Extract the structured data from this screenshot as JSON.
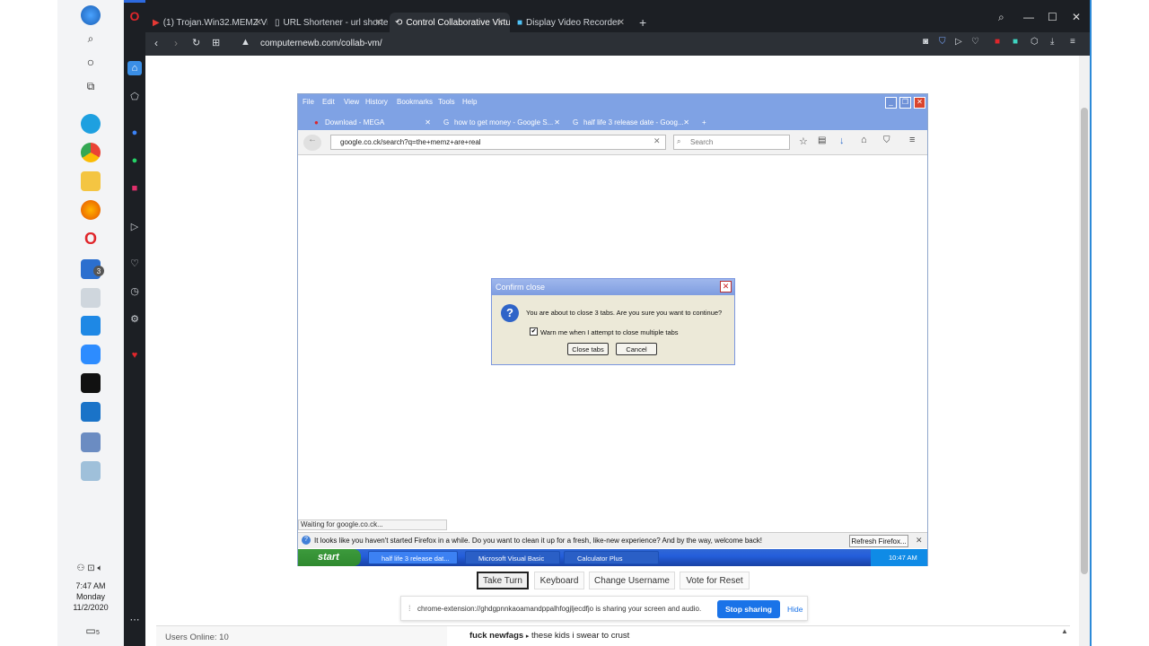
{
  "opera": {
    "tabs": [
      {
        "label": "(1) Trojan.Win32.MEMZ Vi",
        "icon_color": "#e53935"
      },
      {
        "label": "URL Shortener - url shortel",
        "icon_color": "#ffffff"
      },
      {
        "label": "Control Collaborative Virtu",
        "icon_color": "#cccccc"
      },
      {
        "label": "Display Video Recorder",
        "icon_color": "#4fc3f7"
      }
    ],
    "url": "computernewb.com/collab-vm/"
  },
  "windows": {
    "clock": {
      "time": "7:47 AM",
      "day": "Monday",
      "date": "11/2/2020"
    },
    "mail_badge": "3",
    "notif_badge": "5"
  },
  "vm": {
    "firefox": {
      "menu": [
        "File",
        "Edit",
        "View",
        "History",
        "Bookmarks",
        "Tools",
        "Help"
      ],
      "tabs": [
        "Download - MEGA",
        "how to get money - Google S...",
        "half life 3 release date - Goog..."
      ],
      "url": "google.co.ck/search?q=the+memz+are+real",
      "search_placeholder": "Search",
      "status": "Waiting for google.co.ck...",
      "notification": "It looks like you haven't started Firefox in a while. Do you want to clean it up for a fresh, like-new experience? And by the way, welcome back!",
      "refresh_button": "Refresh Firefox..."
    },
    "dialog": {
      "title": "Confirm close",
      "message": "You are about to close 3 tabs. Are you sure you want to continue?",
      "checkbox_label": "Warn me when I attempt to close multiple tabs",
      "checkbox_mark": "✔",
      "close_button": "Close tabs",
      "cancel_button": "Cancel"
    },
    "xp_taskbar": {
      "start": "start",
      "tasks": [
        "half life 3 release dat...",
        "Microsoft Visual Basic",
        "Calculator Plus"
      ],
      "time": "10:47 AM"
    }
  },
  "controls": {
    "take_turn": "Take Turn",
    "keyboard": "Keyboard",
    "change_username": "Change Username",
    "vote_reset": "Vote for Reset"
  },
  "share_bar": {
    "text": "chrome-extension://ghdgpnnkaoamandppalhfogjljecdfjo is sharing your screen and audio.",
    "stop": "Stop sharing",
    "hide": "Hide"
  },
  "chat": {
    "users_online": "Users Online: 10",
    "username": "fuck newfags",
    "separator": "▸",
    "message": "these kids i swear to crust"
  }
}
